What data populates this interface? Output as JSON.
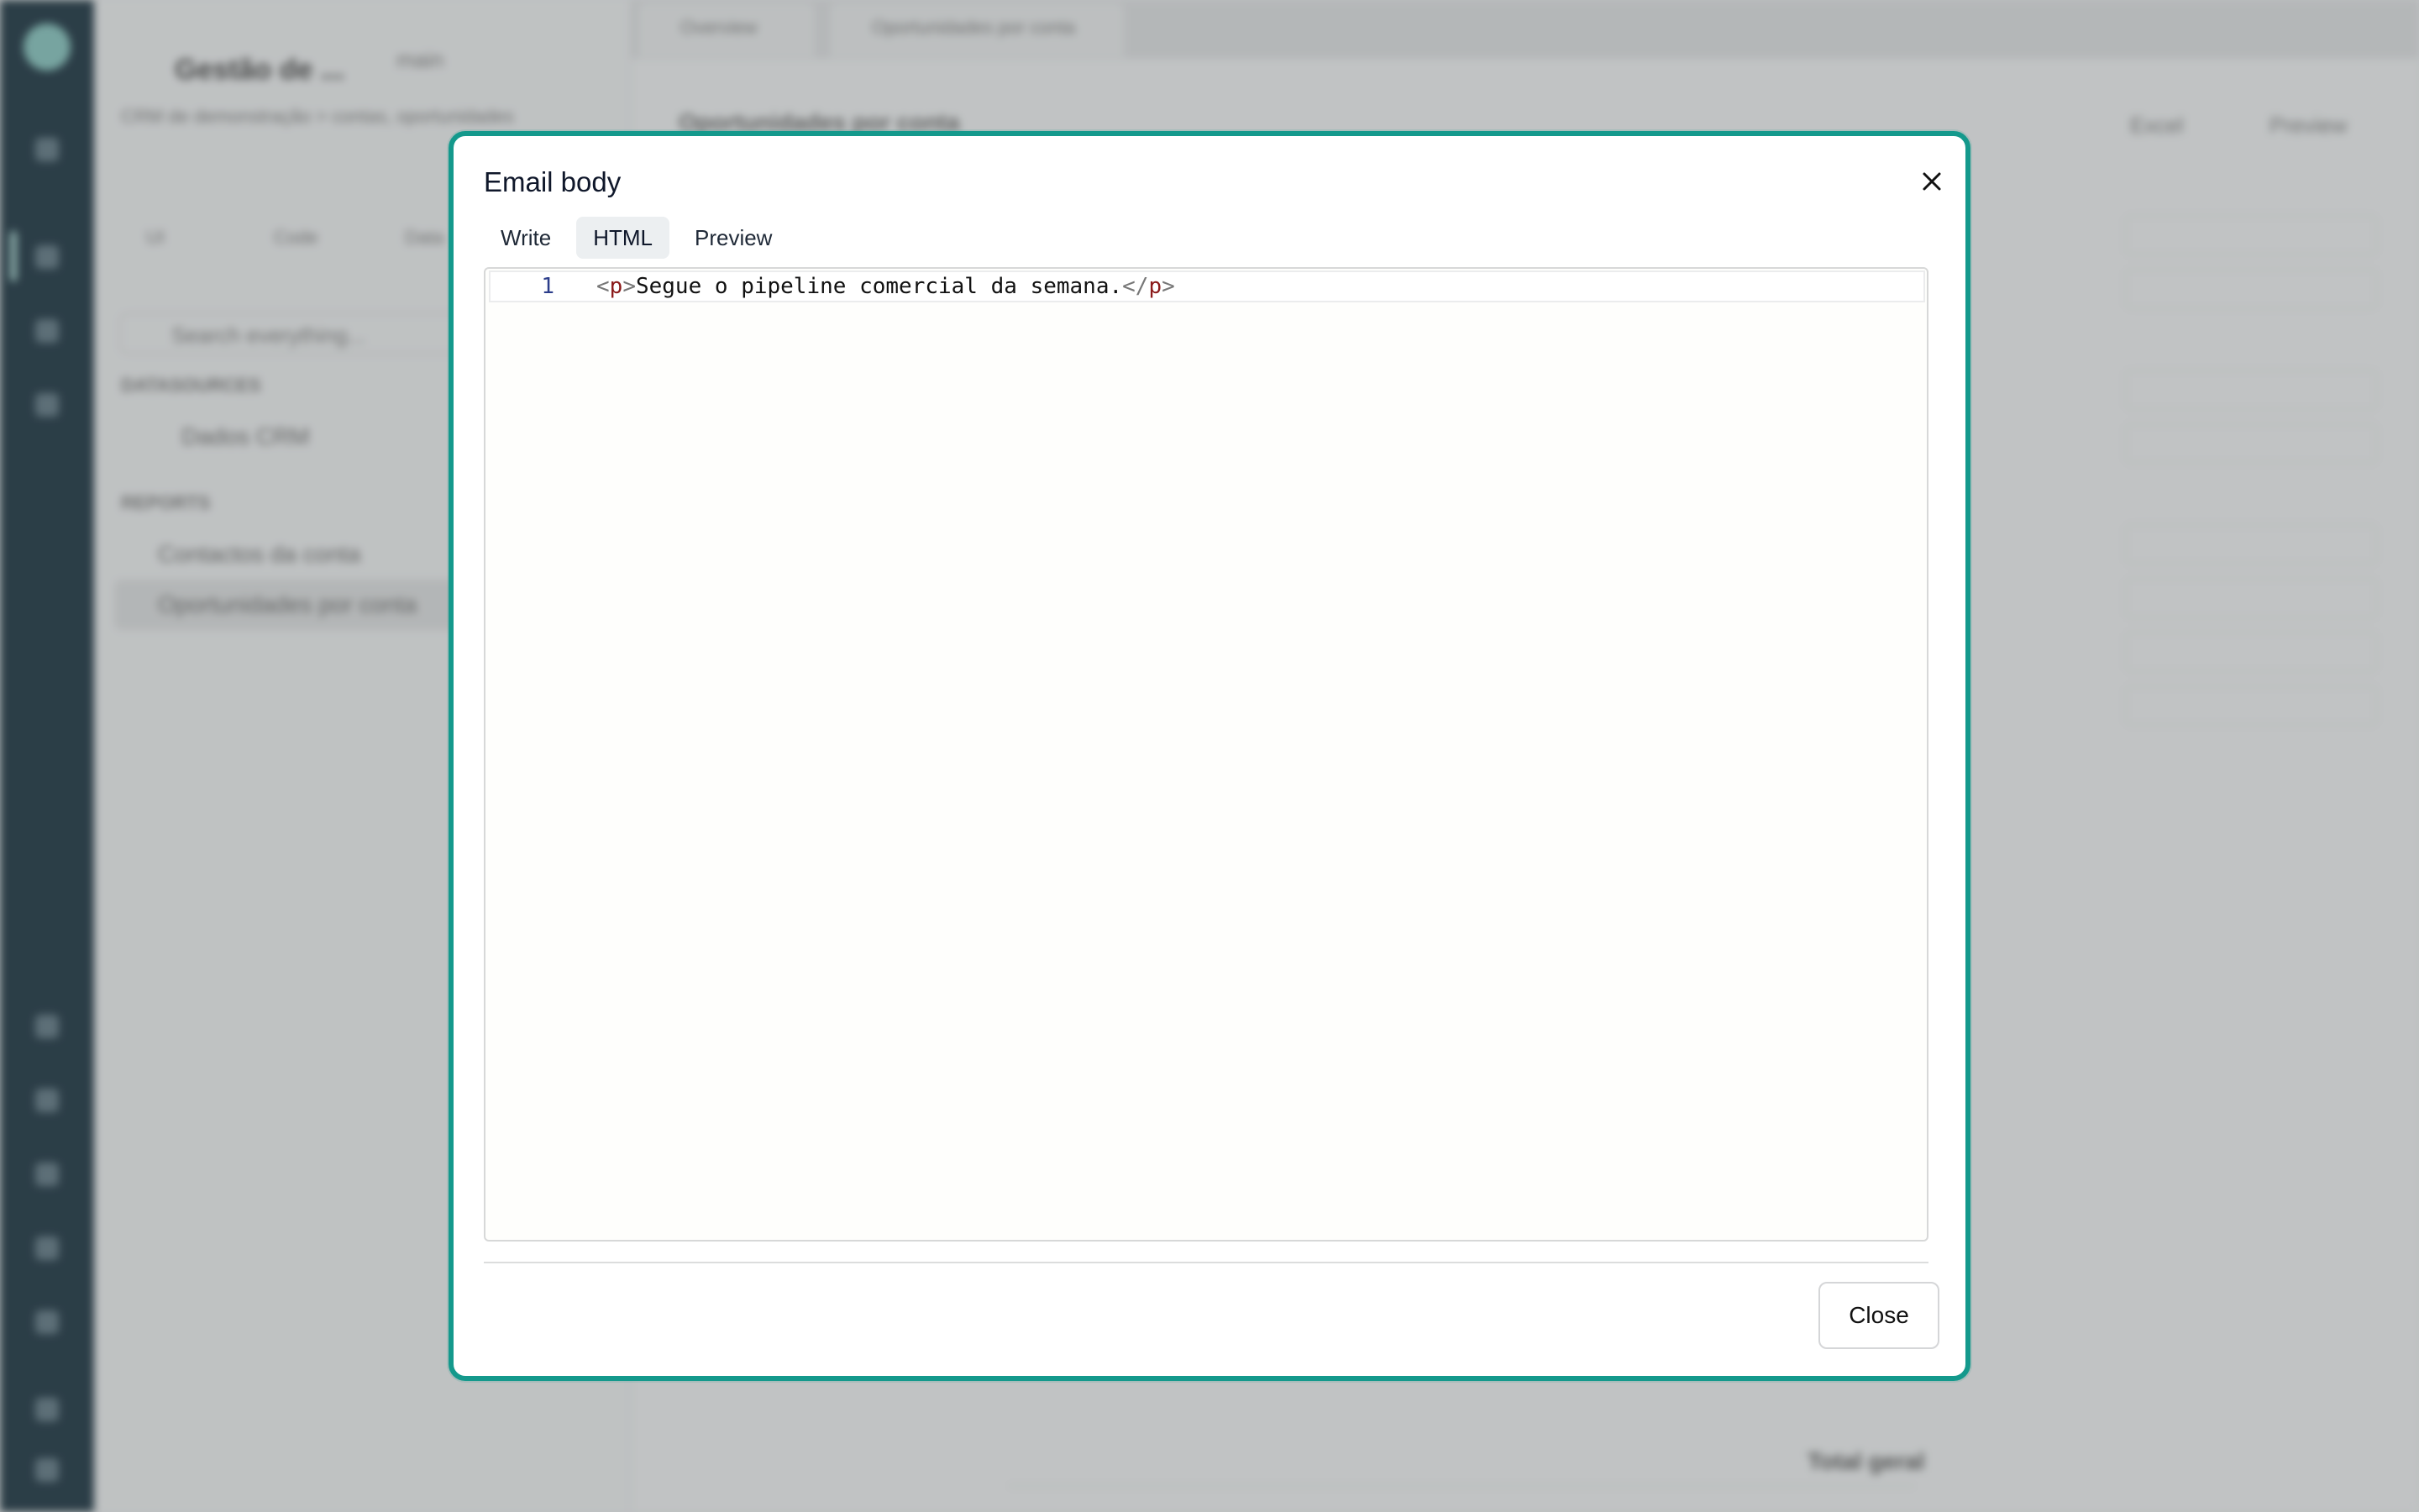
{
  "background": {
    "app_name": "Gestão de ...",
    "branch": "main",
    "breadcrumb": "CRM de demonstração > contas, oportunidades",
    "side_tabs": [
      "UI",
      "Code",
      "Data"
    ],
    "search_placeholder": "Search everything...",
    "datasources_heading": "DATASOURCES",
    "datasource_item": "Dados CRM",
    "reports_heading": "REPORTS",
    "report_items": [
      "Contactos da conta",
      "Oportunidades por conta"
    ],
    "editor_tabs": [
      "Overview",
      "Oportunidades por conta"
    ],
    "report_title": "Oportunidades por conta",
    "actions": [
      "Excel",
      "Preview"
    ],
    "table_footer": "Total geral"
  },
  "modal": {
    "title": "Email body",
    "tabs": [
      {
        "label": "Write",
        "active": false
      },
      {
        "label": "HTML",
        "active": true
      },
      {
        "label": "Preview",
        "active": false
      }
    ],
    "editor": {
      "line_number": "1",
      "tag_open_lt": "<",
      "tag_name": "p",
      "tag_open_gt": ">",
      "text": "Segue o pipeline comercial da semana.",
      "tag_close_lt": "</",
      "tag_close_name": "p",
      "tag_close_gt": ">"
    },
    "close_button": "Close",
    "close_icon": "close-icon"
  },
  "colors": {
    "accent_border": "#14998c",
    "rail": "#0e2430"
  }
}
